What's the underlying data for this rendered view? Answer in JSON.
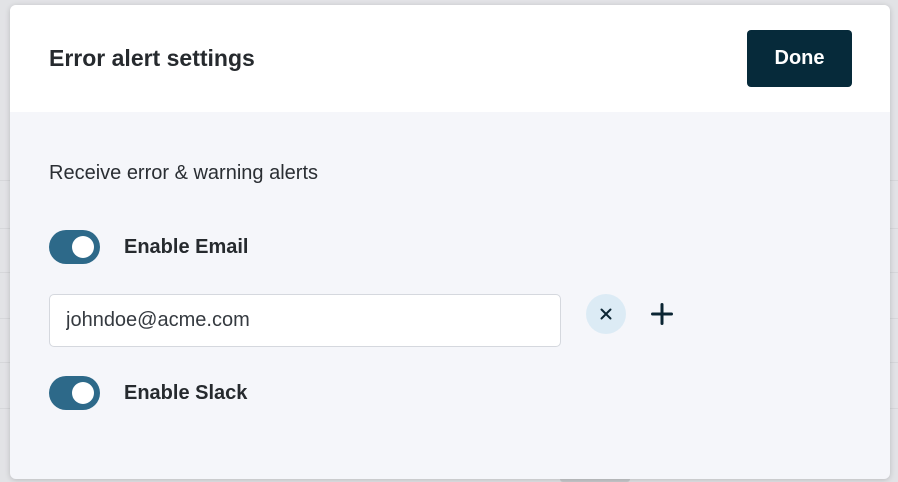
{
  "dialog": {
    "title": "Error alert settings",
    "done_label": "Done"
  },
  "alerts": {
    "section_label": "Receive error & warning alerts",
    "email": {
      "toggle_label": "Enable Email",
      "enabled": true,
      "value": "johndoe@acme.com",
      "remove_icon": "close-icon",
      "add_icon": "plus-icon"
    },
    "slack": {
      "toggle_label": "Enable Slack",
      "enabled": true
    }
  },
  "colors": {
    "primary_button": "#062a3a",
    "toggle_on": "#2d6989",
    "remove_button_bg": "#dcebf5",
    "body_bg": "#f5f6fa"
  }
}
